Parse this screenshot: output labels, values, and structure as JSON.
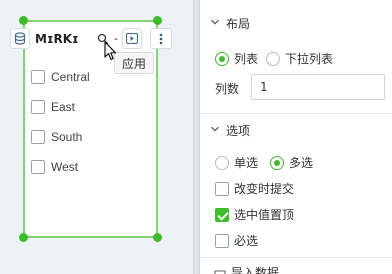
{
  "widget": {
    "toolbar": {
      "title": "MɪRKɪ",
      "dash": "-"
    },
    "tooltip": "应用",
    "options": [
      "Central",
      "East",
      "South",
      "West"
    ]
  },
  "panel": {
    "layout": {
      "title": "布局",
      "display_options": [
        {
          "label": "列表",
          "selected": true
        },
        {
          "label": "下拉列表",
          "selected": false
        }
      ],
      "columns_label": "列数",
      "columns_value": "1"
    },
    "options_section": {
      "title": "选项",
      "select_modes": [
        {
          "label": "单选",
          "selected": false
        },
        {
          "label": "多选",
          "selected": true
        }
      ],
      "checkboxes": [
        {
          "label": "改变时提交",
          "checked": false
        },
        {
          "label": "选中值置顶",
          "checked": true
        },
        {
          "label": "必选",
          "checked": false
        }
      ]
    },
    "next_section_label": "导入数据"
  },
  "colors": {
    "accent": "#3fbc2c",
    "selection_border": "#84d26b",
    "canvas_bg": "#edf2f6"
  }
}
